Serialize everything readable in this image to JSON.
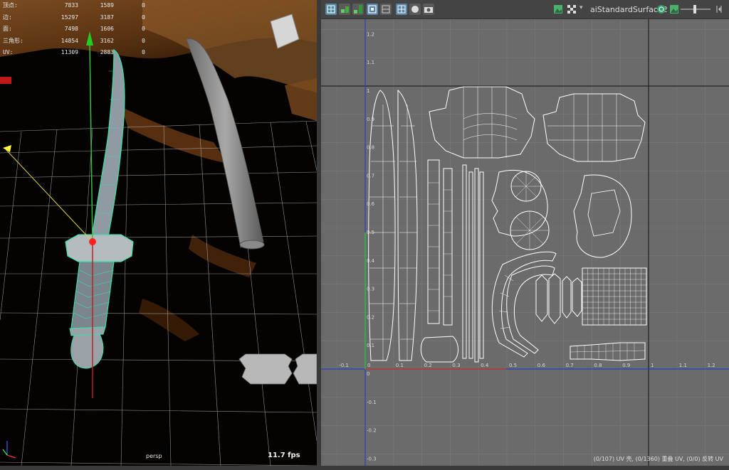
{
  "viewport": {
    "hud": [
      {
        "label": "顶点:",
        "v1": "7833",
        "v2": "1589",
        "v3": "0"
      },
      {
        "label": "边:",
        "v1": "15297",
        "v2": "3187",
        "v3": "0"
      },
      {
        "label": "面:",
        "v1": "7498",
        "v2": "1606",
        "v3": "0"
      },
      {
        "label": "三角形:",
        "v1": "14854",
        "v2": "3162",
        "v3": "0"
      },
      {
        "label": "UV:",
        "v1": "11309",
        "v2": "2883",
        "v3": "0"
      }
    ],
    "camera_label": "persp",
    "fps": "11.7 fps"
  },
  "uv_editor": {
    "shader_name": "aiStandardSurface2",
    "status": "(0/107) UV 壳, (0/1360) 重叠 UV, (0/0) 反转 UV",
    "x_ticks": [
      "-0.1",
      "0",
      "0.1",
      "0.2",
      "0.3",
      "0.4",
      "0.5",
      "0.6",
      "0.7",
      "0.8",
      "0.9",
      "1",
      "1.1",
      "1.2"
    ],
    "y_ticks": [
      "1.2",
      "1.1",
      "1",
      "0.9",
      "0.8",
      "0.7",
      "0.6",
      "0.5",
      "0.4",
      "0.3",
      "0.2",
      "0.1",
      "0",
      "-0.1",
      "-0.2",
      "-0.3"
    ],
    "toolbar_icons": [
      "uv-shell-icon",
      "move-icon",
      "snap-icon",
      "isolate-icon",
      "checker-display-icon",
      "grid-icon",
      "shaded-icon",
      "camera-icon",
      "image-icon",
      "checker-icon",
      "texture-icon",
      "exposure-icon",
      "gamma-icon"
    ]
  },
  "colors": {
    "uv_grid_bg": "#6b6b6b",
    "u_axis": "#c0392b",
    "v_axis": "#2b3fc0",
    "uv_wire": "#ffffff",
    "mesh_select": "#38e0a8",
    "toolbar_active": "#5a83a8"
  }
}
